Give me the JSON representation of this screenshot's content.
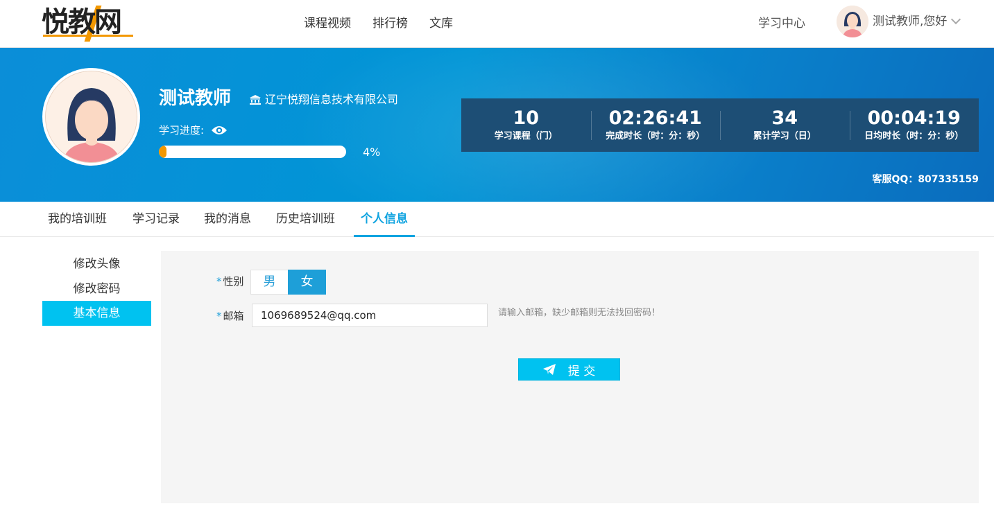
{
  "header": {
    "logo_text": "悦教网",
    "nav": [
      "课程视频",
      "排行榜",
      "文库"
    ],
    "study_center": "学习中心",
    "user_greeting": "测试教师,您好"
  },
  "profile": {
    "name": "测试教师",
    "organization": "辽宁悦翔信息技术有限公司",
    "progress_label": "学习进度:",
    "progress_pct_text": "4%",
    "progress_fraction": 0.04
  },
  "stats": [
    {
      "value": "10",
      "label": "学习课程（门）"
    },
    {
      "value": "02:26:41",
      "label": "完成时长（时：分：秒）"
    },
    {
      "value": "34",
      "label": "累计学习（日）"
    },
    {
      "value": "00:04:19",
      "label": "日均时长（时：分：秒）"
    }
  ],
  "service_qq": "客服QQ：807335159",
  "tabs": [
    "我的培训班",
    "学习记录",
    "我的消息",
    "历史培训班",
    "个人信息"
  ],
  "active_tab": "个人信息",
  "side_menu": [
    "修改头像",
    "修改密码",
    "基本信息"
  ],
  "active_side": "基本信息",
  "form": {
    "gender_label": "性别",
    "gender_options": [
      "男",
      "女"
    ],
    "gender_selected": "女",
    "email_label": "邮箱",
    "email_value": "1069689524@qq.com",
    "email_hint": "请输入邮箱，缺少邮箱则无法找回密码！",
    "required_mark": "*",
    "submit_label": "提 交"
  },
  "colors": {
    "accent": "#00c2f0",
    "selected_gender": "#1e9fd8",
    "progress": "#f39800",
    "banner": "#0095d6",
    "stats_bg": "#1d4e75"
  },
  "icons": [
    "logo",
    "avatar",
    "chevron-down-icon",
    "bank-icon",
    "eye-icon",
    "paper-plane-icon"
  ]
}
